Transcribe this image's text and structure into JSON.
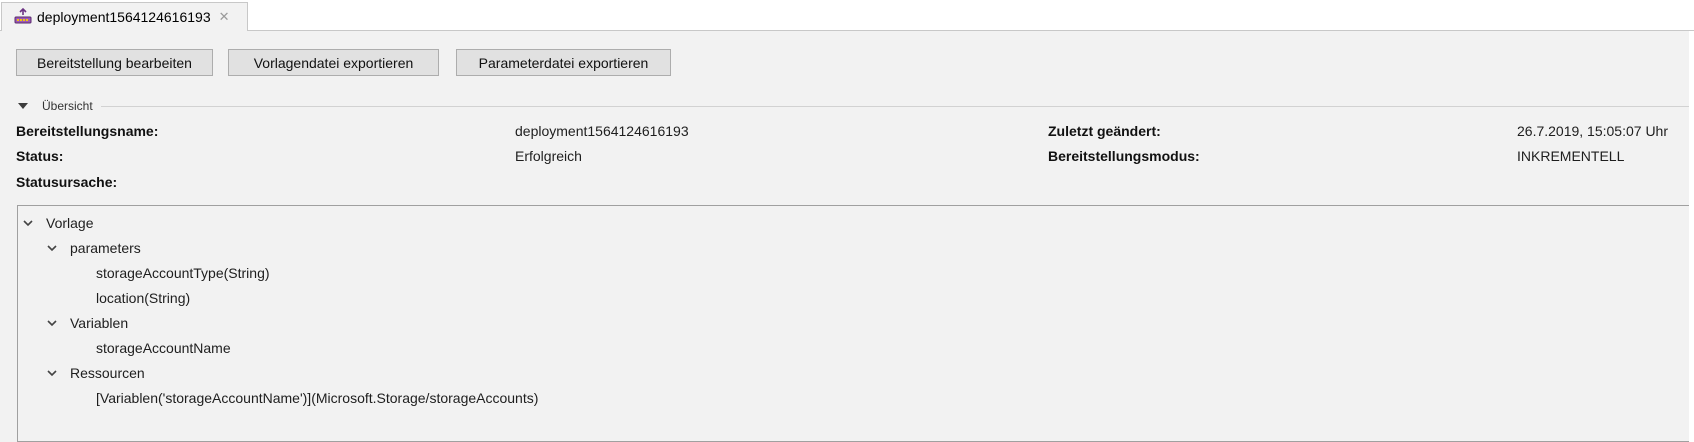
{
  "tab": {
    "title": "deployment1564124616193",
    "close_glyph": "✕",
    "icon": "deployment-icon"
  },
  "toolbar": {
    "edit_label": "Bereitstellung bearbeiten",
    "export_template_label": "Vorlagendatei exportieren",
    "export_params_label": "Parameterdatei exportieren"
  },
  "overview": {
    "title": "Übersicht",
    "props": {
      "name_label": "Bereitstellungsname:",
      "name_value": "deployment1564124616193",
      "modified_label": "Zuletzt geändert:",
      "modified_value": "26.7.2019, 15:05:07 Uhr",
      "status_label": "Status:",
      "status_value": "Erfolgreich",
      "mode_label": "Bereitstellungsmodus:",
      "mode_value": "INKREMENTELL",
      "reason_label": "Statusursache:"
    }
  },
  "tree": {
    "root": "Vorlage",
    "parameters": {
      "label": "parameters",
      "items": [
        "storageAccountType(String)",
        "location(String)"
      ]
    },
    "variables": {
      "label": "Variablen",
      "items": [
        "storageAccountName"
      ]
    },
    "resources": {
      "label": "Ressourcen",
      "items": [
        "[Variablen('storageAccountName')](Microsoft.Storage/storageAccounts)"
      ]
    }
  },
  "colors": {
    "background": "#f2f2f2",
    "button": "#e1e1e1",
    "border": "#adadad",
    "icon_purple": "#9b59b6"
  }
}
